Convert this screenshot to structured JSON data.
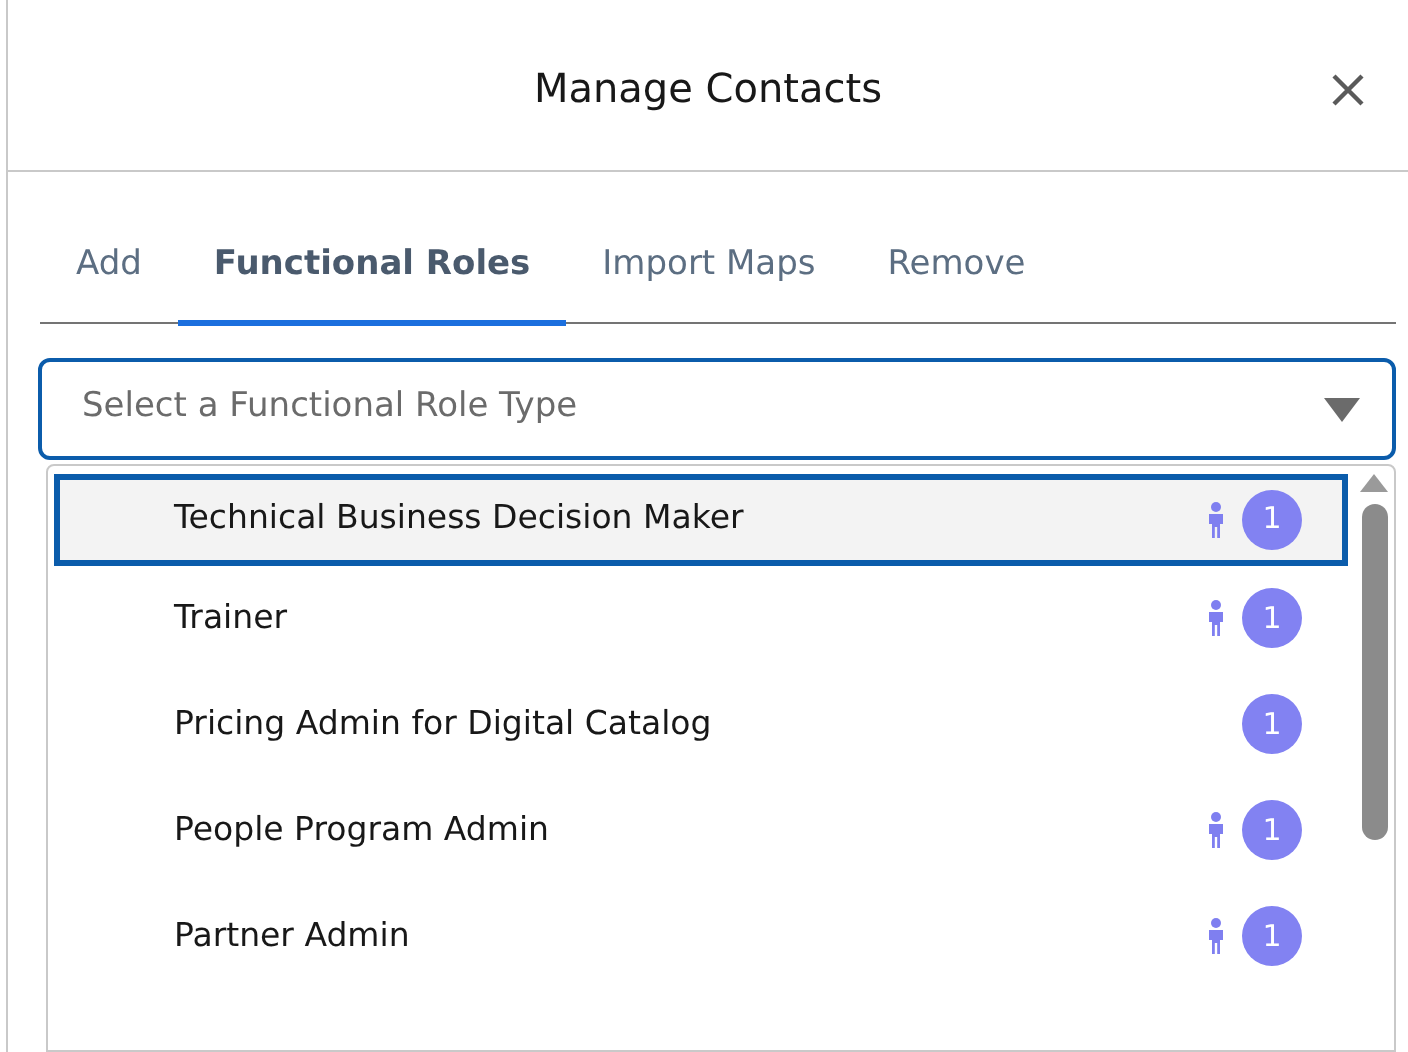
{
  "modal": {
    "title": "Manage Contacts"
  },
  "tabs": [
    {
      "label": "Add",
      "selected": false
    },
    {
      "label": "Functional Roles",
      "selected": true
    },
    {
      "label": "Import Maps",
      "selected": false
    },
    {
      "label": "Remove",
      "selected": false
    }
  ],
  "combobox": {
    "placeholder": "Select a Functional Role Type"
  },
  "options": [
    {
      "label": "Technical Business Decision Maker",
      "selected": true,
      "has_person_icon": true,
      "count": "1"
    },
    {
      "label": "Trainer",
      "selected": false,
      "has_person_icon": true,
      "count": "1"
    },
    {
      "label": "Pricing Admin for Digital Catalog",
      "selected": false,
      "has_person_icon": false,
      "count": "1"
    },
    {
      "label": "People Program Admin",
      "selected": false,
      "has_person_icon": true,
      "count": "1"
    },
    {
      "label": "Partner Admin",
      "selected": false,
      "has_person_icon": true,
      "count": "1"
    }
  ]
}
